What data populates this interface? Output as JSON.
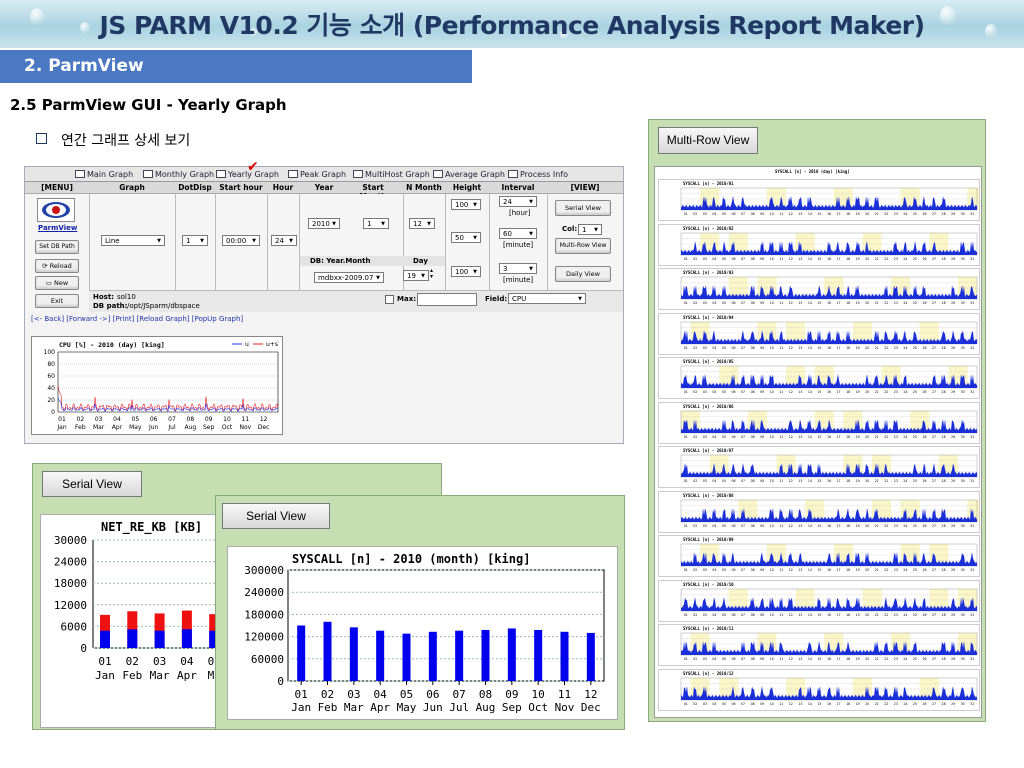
{
  "banner": {
    "title": "JS PARM V10.2 기능 소개 (Performance Analysis Report Maker)"
  },
  "section": {
    "label": "2.  ParmView"
  },
  "subheading": "2.5   ParmView   GUI - Yearly Graph",
  "bullet": "연간 그래프 상세 보기",
  "gui": {
    "tabs": [
      "Main Graph",
      "Monthly Graph",
      "Yearly Graph",
      "Peak Graph",
      "MultiHost Graph",
      "Average Graph",
      "Process Info"
    ],
    "headers": [
      "[MENU]",
      "Graph",
      "DotDisp",
      "Start hour",
      "Hour",
      "Year",
      "Start Month",
      "N Month",
      "Height",
      "Interval",
      "[VIEW]"
    ],
    "menu": {
      "parmview": "ParmView",
      "set_db_path": "Set DB Path",
      "reload": "Reload",
      "new": "New",
      "exit": "Exit"
    },
    "graph_select": "Line",
    "dotdisp_select": "1",
    "start_hour_select": "00:00",
    "hour_select": "24",
    "year_select": "2010",
    "start_month_select": "1",
    "n_month_select": "12",
    "height_selects": [
      "100",
      "50",
      "100"
    ],
    "interval": [
      {
        "value": "24",
        "unit": "[hour]"
      },
      {
        "value": "60",
        "unit": "[minute]"
      },
      {
        "value": "3",
        "unit": "[minute]"
      }
    ],
    "col_label": "Col:",
    "col_select": "1",
    "view_buttons": [
      "Serial View",
      "Multi-Row View",
      "Daily View"
    ],
    "db_label": "DB: Year.Month",
    "day_label": "Day",
    "db_select": "mdbxx-2009.07",
    "day_select": "19",
    "host_label": "Host:",
    "host_value": "sol10",
    "dbpath_label": "DB path:",
    "dbpath_value": "/opt/JSparm/dbspace",
    "max_label": "Max:",
    "field_label": "Field:",
    "field_select": "CPU",
    "nav_links": "[<- Back] [Forward ->] [Print] [Reload Graph] [PopUp Graph]",
    "mini_chart": {
      "title": "CPU [%] - 2010 (day) [king]",
      "legend": [
        "u",
        "u+s"
      ],
      "yticks": [
        "100",
        "80",
        "60",
        "40",
        "20",
        "0"
      ],
      "months": [
        "01",
        "02",
        "03",
        "04",
        "05",
        "06",
        "07",
        "08",
        "09",
        "10",
        "11",
        "12"
      ],
      "mnames": [
        "Jan",
        "Feb",
        "Mar",
        "Apr",
        "May",
        "Jun",
        "Jul",
        "Aug",
        "Sep",
        "Oct",
        "Nov",
        "Dec"
      ]
    }
  },
  "multirow": {
    "button": "Multi-Row View",
    "rows": [
      "SYSCALL [n] - 2010/01",
      "SYSCALL [n] - 2010/02",
      "SYSCALL [n] - 2010/03",
      "SYSCALL [n] - 2010/04",
      "SYSCALL [n] - 2010/05",
      "SYSCALL [n] - 2010/06",
      "SYSCALL [n] - 2010/07",
      "SYSCALL [n] - 2010/08",
      "SYSCALL [n] - 2010/09",
      "SYSCALL [n] - 2010/10",
      "SYSCALL [n] - 2010/11",
      "SYSCALL [n] - 2010/12"
    ],
    "header_title": "SYSCALL [n] - 2010 (day) [king]"
  },
  "serial1": {
    "button": "Serial View",
    "title": "NET_RE_KB [KB]"
  },
  "serial2": {
    "button": "Serial View",
    "title": "SYSCALL [n] - 2010 (month) [king]"
  },
  "chart_data": [
    {
      "type": "bar",
      "title": "SYSCALL [n] - 2010 (month) [king]",
      "categories": [
        "01",
        "02",
        "03",
        "04",
        "05",
        "06",
        "07",
        "08",
        "09",
        "10",
        "11",
        "12"
      ],
      "category_names": [
        "Jan",
        "Feb",
        "Mar",
        "Apr",
        "May",
        "Jun",
        "Jul",
        "Aug",
        "Sep",
        "Oct",
        "Nov",
        "Dec"
      ],
      "values": [
        150000,
        160000,
        145000,
        136000,
        128000,
        133000,
        136000,
        138000,
        142000,
        138000,
        133000,
        130000
      ],
      "yticks": [
        0,
        60000,
        120000,
        180000,
        240000,
        300000
      ],
      "ylim": [
        0,
        300000
      ],
      "color": "#0000ee"
    },
    {
      "type": "bar",
      "title": "NET_RE_KB [KB]",
      "categories": [
        "01",
        "02",
        "03",
        "04",
        "05"
      ],
      "category_names": [
        "Jan",
        "Feb",
        "Mar",
        "Apr",
        "Ma"
      ],
      "series": [
        {
          "values": [
            4800,
            5200,
            4800,
            5200,
            4800
          ],
          "color": "#0000ee"
        },
        {
          "values": [
            9200,
            10200,
            9600,
            10400,
            9400
          ],
          "color": "#ee1111"
        }
      ],
      "yticks": [
        0,
        6000,
        12000,
        18000,
        24000,
        30000
      ],
      "ylim": [
        0,
        30000
      ]
    }
  ]
}
